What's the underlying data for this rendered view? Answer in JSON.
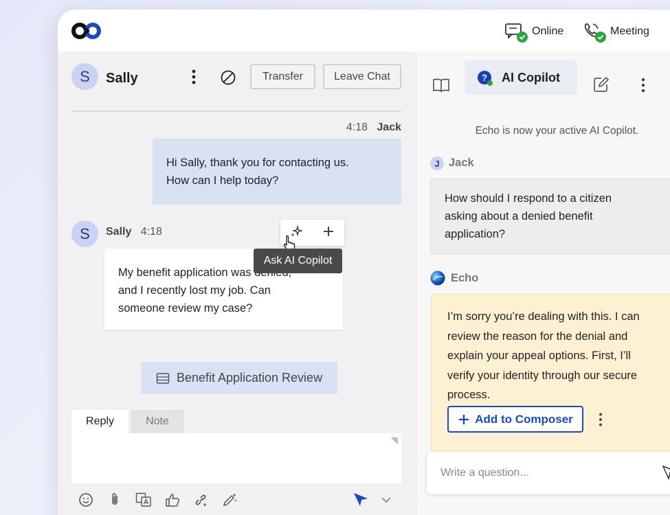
{
  "topbar": {
    "status_online": "Online",
    "status_meeting": "Meeting"
  },
  "chat_header": {
    "avatar_letter": "S",
    "name": "Sally",
    "transfer_label": "Transfer",
    "leave_label": "Leave Chat"
  },
  "messages": [
    {
      "time": "4:18",
      "author": "Jack",
      "lines": [
        "Hi Sally, thank you for contacting us.",
        "How can I help today?"
      ]
    },
    {
      "avatar_letter": "S",
      "author": "Sally",
      "time": "4:18",
      "lines": [
        "My benefit application was denied,",
        "and I recently lost my job. Can",
        "someone review my case?"
      ]
    }
  ],
  "tooltip": "Ask AI Copilot",
  "card_button": "Benefit Application Review",
  "composer": {
    "tab_reply": "Reply",
    "tab_note": "Note"
  },
  "copilot": {
    "tab_label": "AI Copilot",
    "system_message": "Echo is now your active AI Copilot.",
    "user_avatar": "J",
    "user_name": "Jack",
    "question_lines": [
      "How should I respond to a citizen",
      "asking about a denied benefit",
      "application?"
    ],
    "bot_name": "Echo",
    "answer_lines": [
      "I’m sorry you’re dealing with this. I can",
      "review the reason for the denial and",
      "explain your appeal options. First, I’ll",
      "verify your identity through our secure",
      "process."
    ],
    "add_button": "Add to Composer",
    "input_placeholder": "Write a question..."
  },
  "colors": {
    "accent": "#1a49c6",
    "status_green": "#2aa63d",
    "agent_bubble": "#d8e2f3",
    "answer_bubble": "#fdf1d3"
  }
}
